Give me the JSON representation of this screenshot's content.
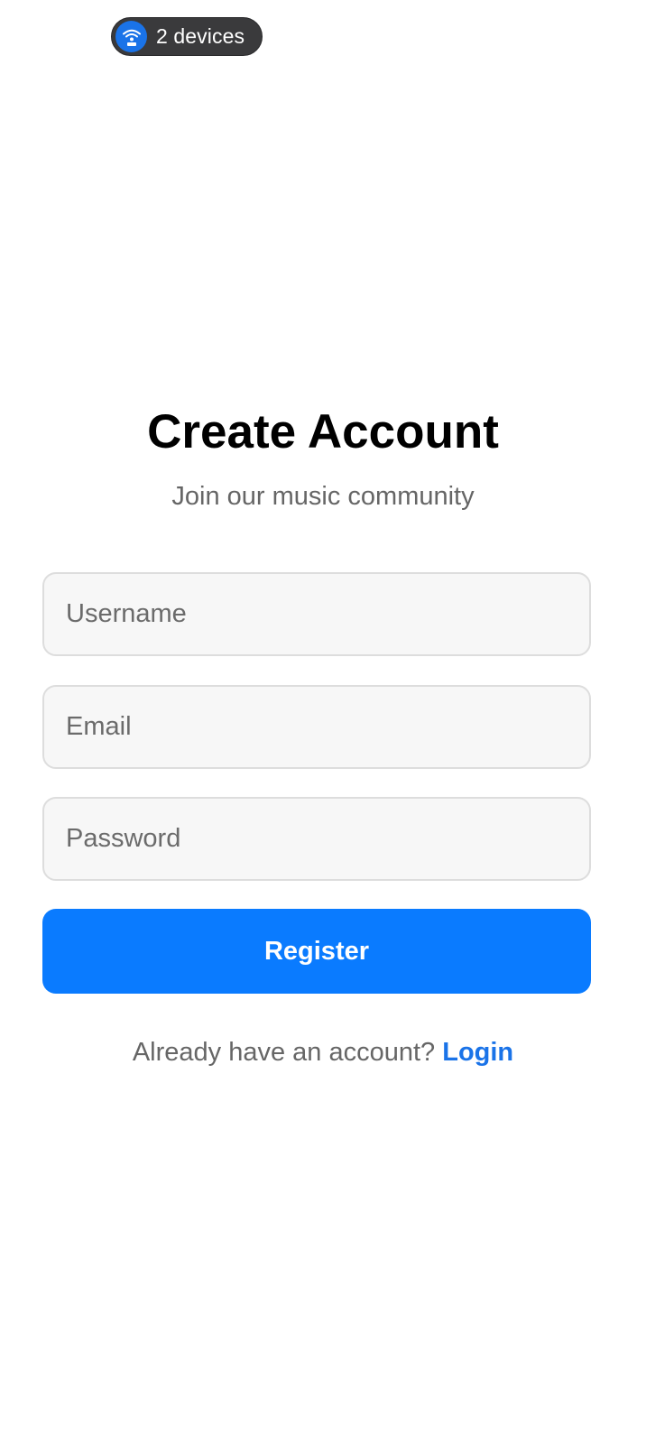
{
  "device_indicator": {
    "label": "2 devices",
    "icon": "wifi-devices-icon",
    "icon_color": "#1a73e8"
  },
  "header": {
    "title": "Create Account",
    "subtitle": "Join our music community"
  },
  "form": {
    "username_placeholder": "Username",
    "email_placeholder": "Email",
    "password_placeholder": "Password",
    "username_value": "",
    "email_value": "",
    "password_value": "",
    "register_label": "Register"
  },
  "footer": {
    "prompt": "Already have an account?",
    "login_label": "Login"
  },
  "colors": {
    "accent": "#0a7bff",
    "link": "#1a73e8",
    "field_background": "#f7f7f7",
    "field_border": "#dddddd",
    "muted_text": "#666666"
  }
}
